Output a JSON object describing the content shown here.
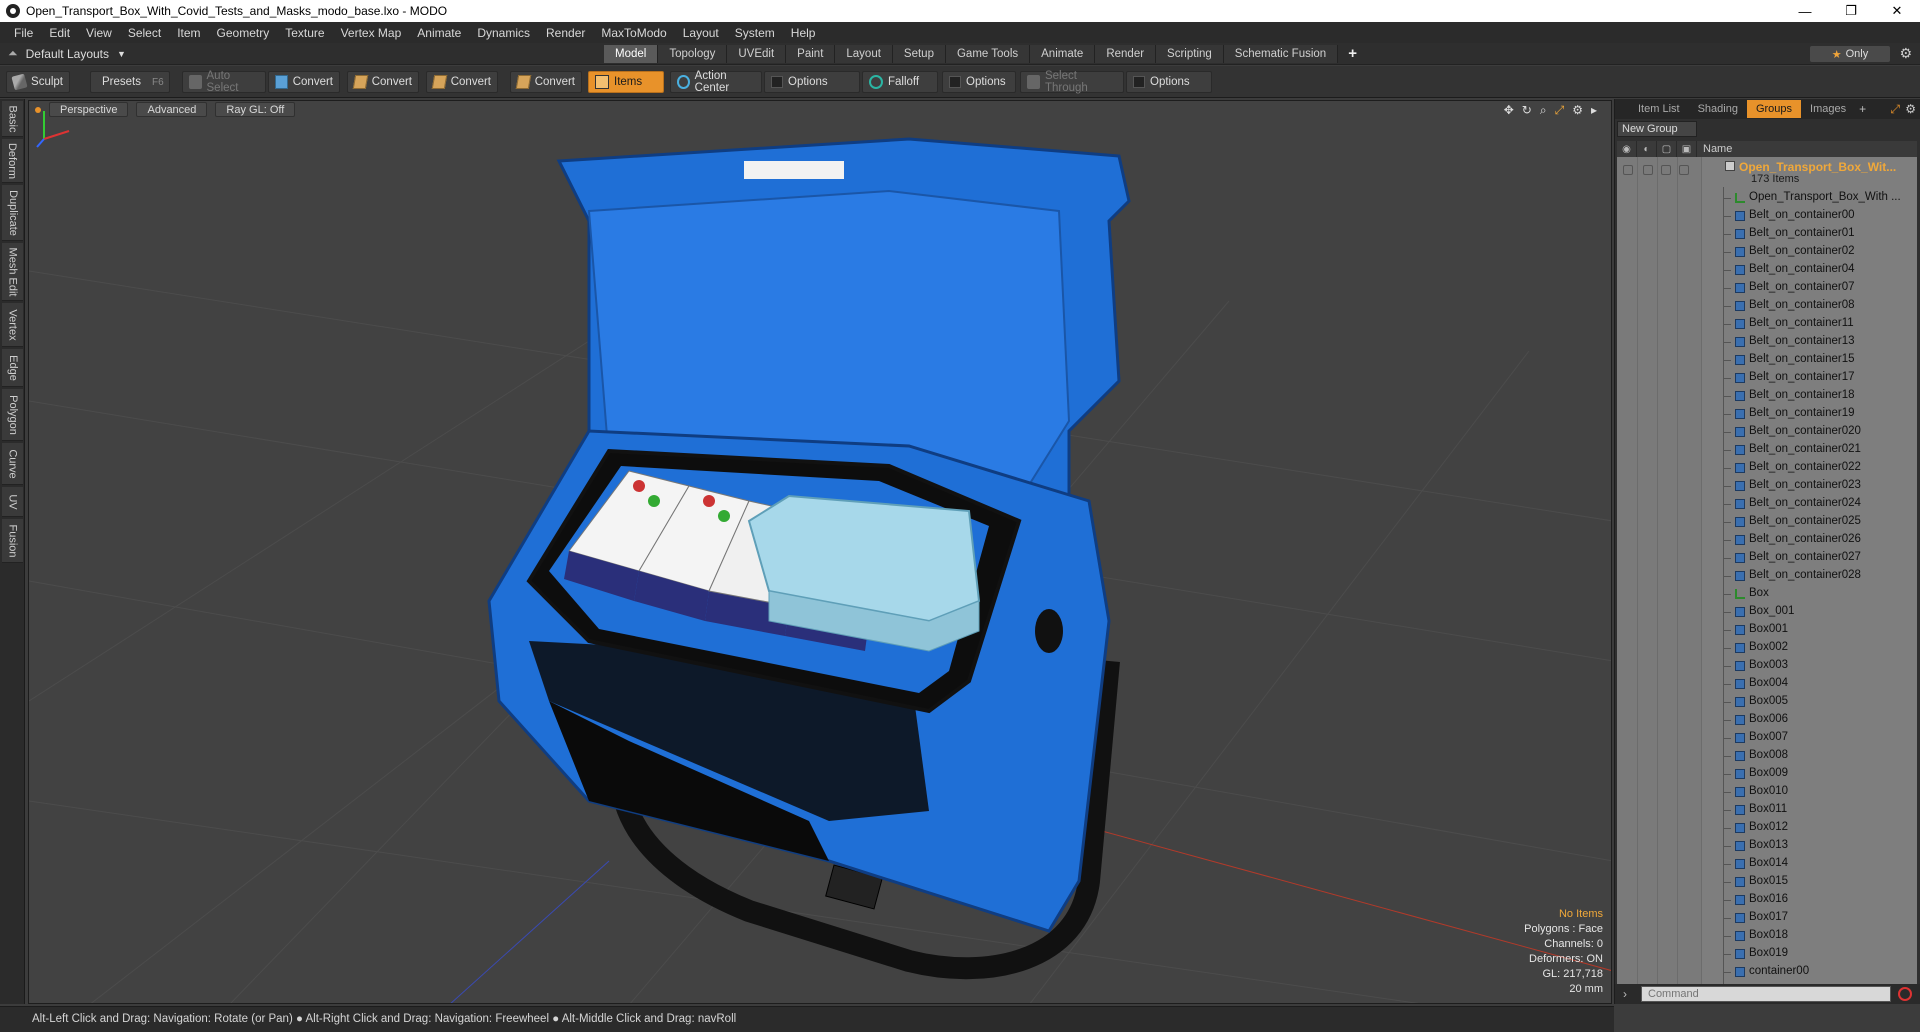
{
  "window": {
    "title": "Open_Transport_Box_With_Covid_Tests_and_Masks_modo_base.lxo - MODO",
    "minimize": "—",
    "maximize": "❐",
    "close": "✕"
  },
  "menu": {
    "items": [
      "File",
      "Edit",
      "View",
      "Select",
      "Item",
      "Geometry",
      "Texture",
      "Vertex Map",
      "Animate",
      "Dynamics",
      "Render",
      "MaxToModo",
      "Layout",
      "System",
      "Help"
    ]
  },
  "layoutbar": {
    "layout_name": "Default Layouts",
    "tabs": [
      "Model",
      "Topology",
      "UVEdit",
      "Paint",
      "Layout",
      "Setup",
      "Game Tools",
      "Animate",
      "Render",
      "Scripting",
      "Schematic Fusion"
    ],
    "active_tab": "Model",
    "only_label": "Only"
  },
  "toolbar": {
    "sculpt": "Sculpt",
    "presets": "Presets",
    "presets_hotkey": "F6",
    "auto_select": "Auto Select",
    "convert1": "Convert",
    "convert2": "Convert",
    "convert3": "Convert",
    "convert4": "Convert",
    "items": "Items",
    "action_center": "Action Center",
    "options1": "Options",
    "falloff": "Falloff",
    "options2": "Options",
    "select_through": "Select Through",
    "options3": "Options"
  },
  "left_tabs": [
    "Basic",
    "Deform",
    "Duplicate",
    "Mesh Edit",
    "Vertex",
    "Edge",
    "Polygon",
    "Curve",
    "UV",
    "Fusion"
  ],
  "viewport": {
    "view": "Perspective",
    "shading": "Advanced",
    "raygl": "Ray GL: Off",
    "info": {
      "no_items": "No Items",
      "polygons": "Polygons : Face",
      "channels": "Channels: 0",
      "deformers": "Deformers: ON",
      "gl": "GL: 217,718",
      "scale": "20 mm"
    },
    "colors": {
      "box_blue": "#1f6fd6",
      "box_dark": "#0a0a0a",
      "grid_bg": "#424242"
    }
  },
  "rightpanel": {
    "tabs": [
      "Item List",
      "Shading",
      "Groups",
      "Images"
    ],
    "active_tab": "Groups",
    "new_group": "New Group",
    "name_header": "Name",
    "root_name": "Open_Transport_Box_Wit...",
    "root_count": "173 Items",
    "items": [
      {
        "name": "Open_Transport_Box_With ...",
        "type": "locator"
      },
      {
        "name": "Belt_on_container00",
        "type": "mesh"
      },
      {
        "name": "Belt_on_container01",
        "type": "mesh"
      },
      {
        "name": "Belt_on_container02",
        "type": "mesh"
      },
      {
        "name": "Belt_on_container04",
        "type": "mesh"
      },
      {
        "name": "Belt_on_container07",
        "type": "mesh"
      },
      {
        "name": "Belt_on_container08",
        "type": "mesh"
      },
      {
        "name": "Belt_on_container11",
        "type": "mesh"
      },
      {
        "name": "Belt_on_container13",
        "type": "mesh"
      },
      {
        "name": "Belt_on_container15",
        "type": "mesh"
      },
      {
        "name": "Belt_on_container17",
        "type": "mesh"
      },
      {
        "name": "Belt_on_container18",
        "type": "mesh"
      },
      {
        "name": "Belt_on_container19",
        "type": "mesh"
      },
      {
        "name": "Belt_on_container020",
        "type": "mesh"
      },
      {
        "name": "Belt_on_container021",
        "type": "mesh"
      },
      {
        "name": "Belt_on_container022",
        "type": "mesh"
      },
      {
        "name": "Belt_on_container023",
        "type": "mesh"
      },
      {
        "name": "Belt_on_container024",
        "type": "mesh"
      },
      {
        "name": "Belt_on_container025",
        "type": "mesh"
      },
      {
        "name": "Belt_on_container026",
        "type": "mesh"
      },
      {
        "name": "Belt_on_container027",
        "type": "mesh"
      },
      {
        "name": "Belt_on_container028",
        "type": "mesh"
      },
      {
        "name": "Box",
        "type": "locator"
      },
      {
        "name": "Box_001",
        "type": "mesh"
      },
      {
        "name": "Box001",
        "type": "mesh"
      },
      {
        "name": "Box002",
        "type": "mesh"
      },
      {
        "name": "Box003",
        "type": "mesh"
      },
      {
        "name": "Box004",
        "type": "mesh"
      },
      {
        "name": "Box005",
        "type": "mesh"
      },
      {
        "name": "Box006",
        "type": "mesh"
      },
      {
        "name": "Box007",
        "type": "mesh"
      },
      {
        "name": "Box008",
        "type": "mesh"
      },
      {
        "name": "Box009",
        "type": "mesh"
      },
      {
        "name": "Box010",
        "type": "mesh"
      },
      {
        "name": "Box011",
        "type": "mesh"
      },
      {
        "name": "Box012",
        "type": "mesh"
      },
      {
        "name": "Box013",
        "type": "mesh"
      },
      {
        "name": "Box014",
        "type": "mesh"
      },
      {
        "name": "Box015",
        "type": "mesh"
      },
      {
        "name": "Box016",
        "type": "mesh"
      },
      {
        "name": "Box017",
        "type": "mesh"
      },
      {
        "name": "Box018",
        "type": "mesh"
      },
      {
        "name": "Box019",
        "type": "mesh"
      },
      {
        "name": "container00",
        "type": "mesh"
      }
    ],
    "command_placeholder": "Command"
  },
  "statusbar": {
    "text": "Alt-Left Click and Drag: Navigation: Rotate (or Pan) ● Alt-Right Click and Drag: Navigation: Freewheel ● Alt-Middle Click and Drag: navRoll"
  }
}
